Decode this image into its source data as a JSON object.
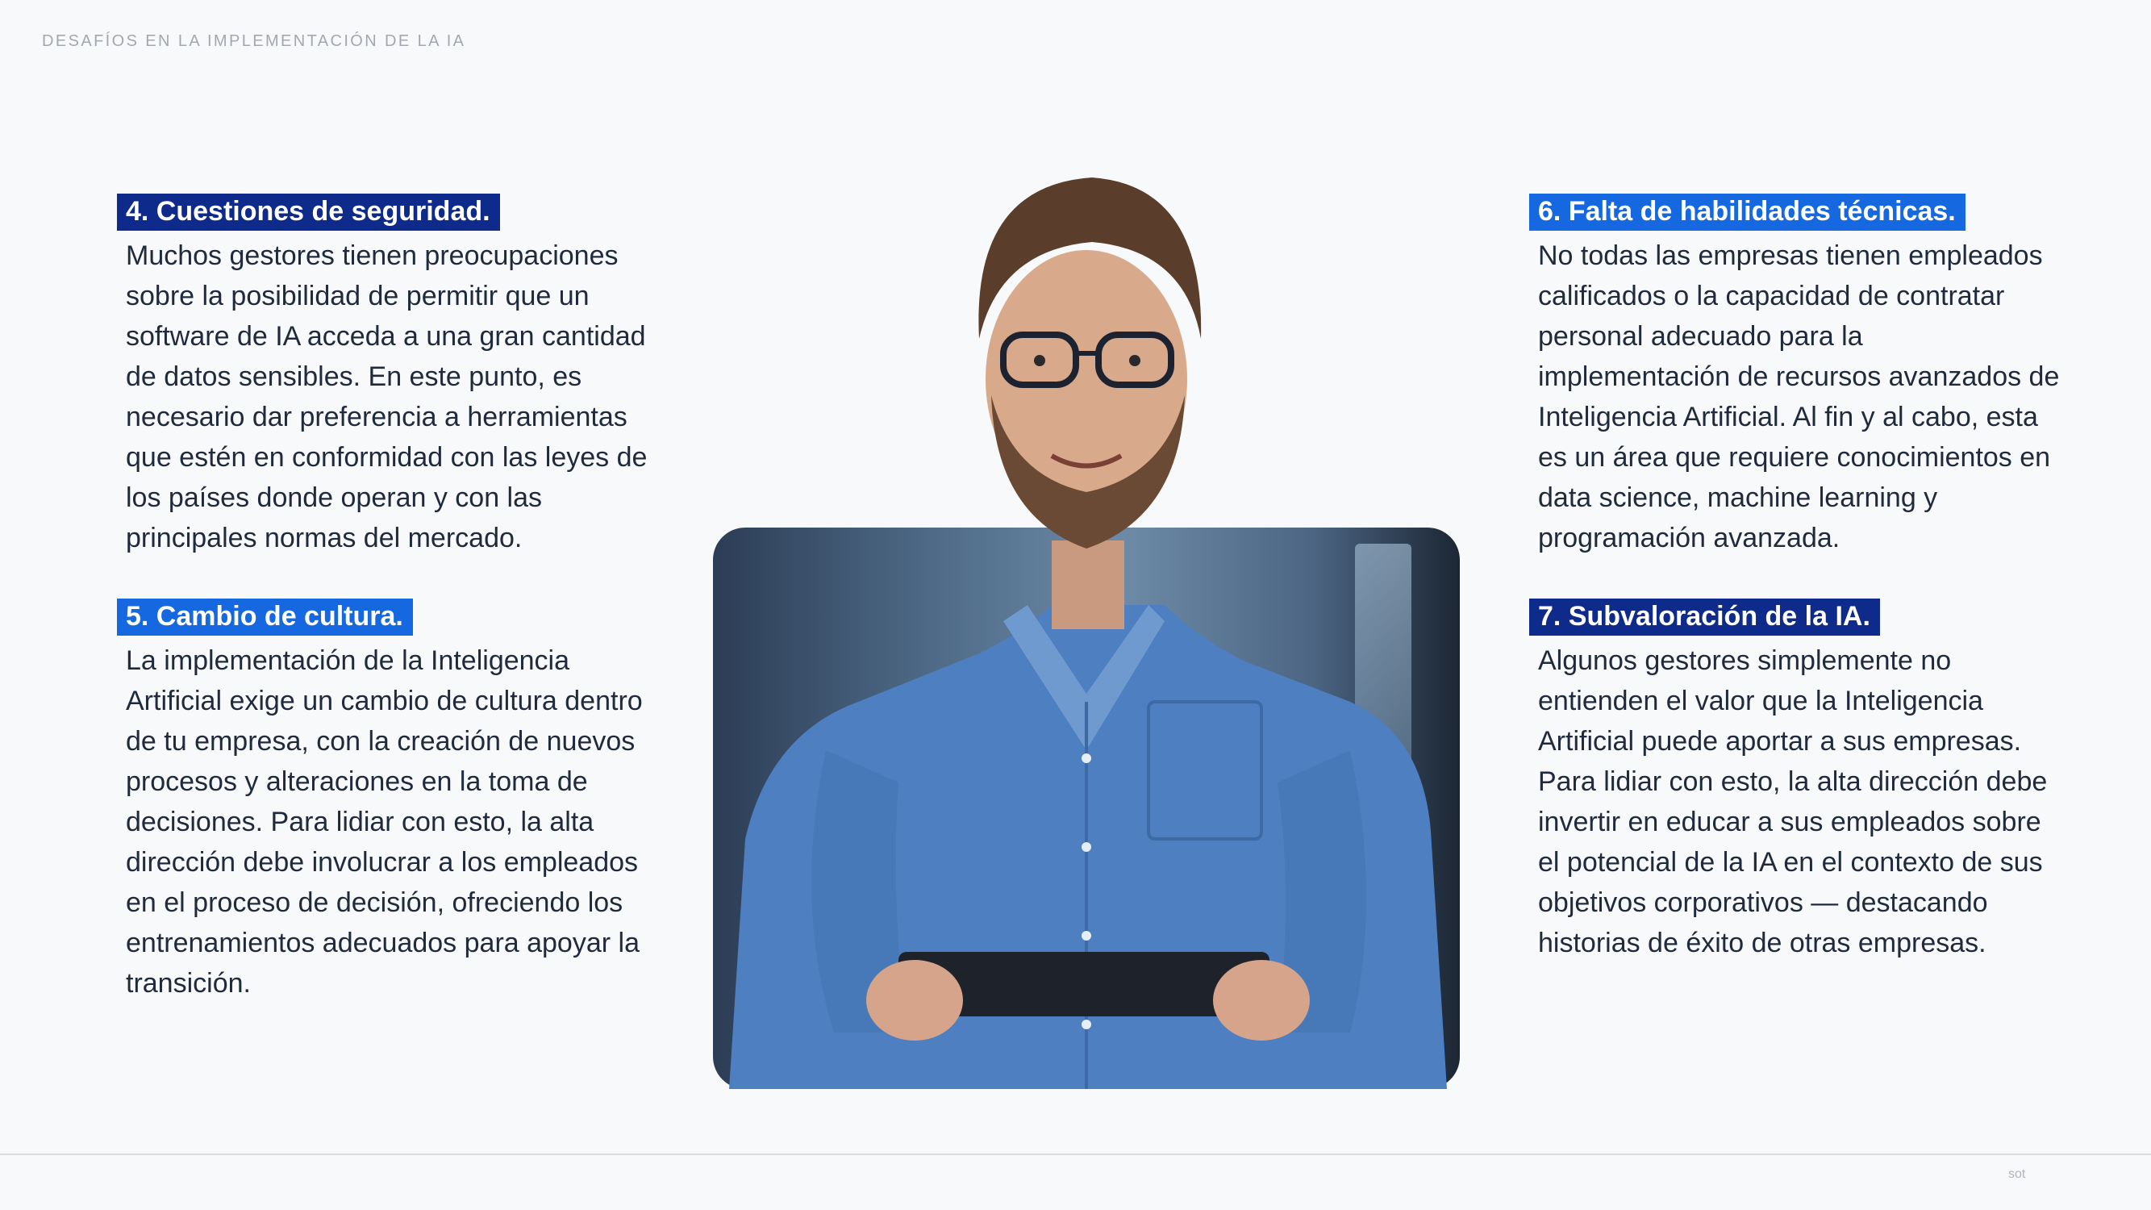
{
  "header": {
    "title": "DESAFÍOS EN LA IMPLEMENTACIÓN DE LA IA"
  },
  "sections": {
    "s4": {
      "heading": "4. Cuestiones de seguridad.",
      "body": "Muchos gestores tienen preocupaciones sobre la posibilidad de permitir que un software de IA acceda a una gran cantidad de datos sensibles. En este punto, es necesario dar preferencia a herramientas que estén en conformidad con las leyes de los países donde operan y con las principales normas del mercado."
    },
    "s5": {
      "heading": "5. Cambio de cultura.",
      "body": "La implementación de la Inteligencia Artificial exige un cambio de cultura dentro de tu empresa, con la creación de nuevos procesos y alteraciones en la toma de decisiones. Para lidiar con esto, la alta dirección debe involucrar a los empleados en el proceso de decisión, ofreciendo los entrenamientos adecuados para apoyar la transición."
    },
    "s6": {
      "heading": "6. Falta de habilidades técnicas.",
      "body": "No todas las empresas tienen empleados calificados o la capacidad de contratar personal adecuado para la implementación de recursos avanzados de Inteligencia Artificial. Al fin y al cabo, esta es un área que requiere conocimientos en data science, machine learning y programación avanzada."
    },
    "s7": {
      "heading": "7. Subvaloración de la IA.",
      "body": "Algunos gestores simplemente no entienden el valor que la Inteligencia Artificial puede aportar a sus empresas. Para lidiar con esto, la alta dirección debe invertir en educar a sus empleados sobre el potencial de la IA en el contexto de sus objetivos corporativos — destacando historias de éxito de otras empresas."
    }
  },
  "footer": {
    "page_number": "sot"
  },
  "colors": {
    "navy": "#0e2a8a",
    "blue": "#1668e0",
    "background": "#f8f9fa"
  }
}
